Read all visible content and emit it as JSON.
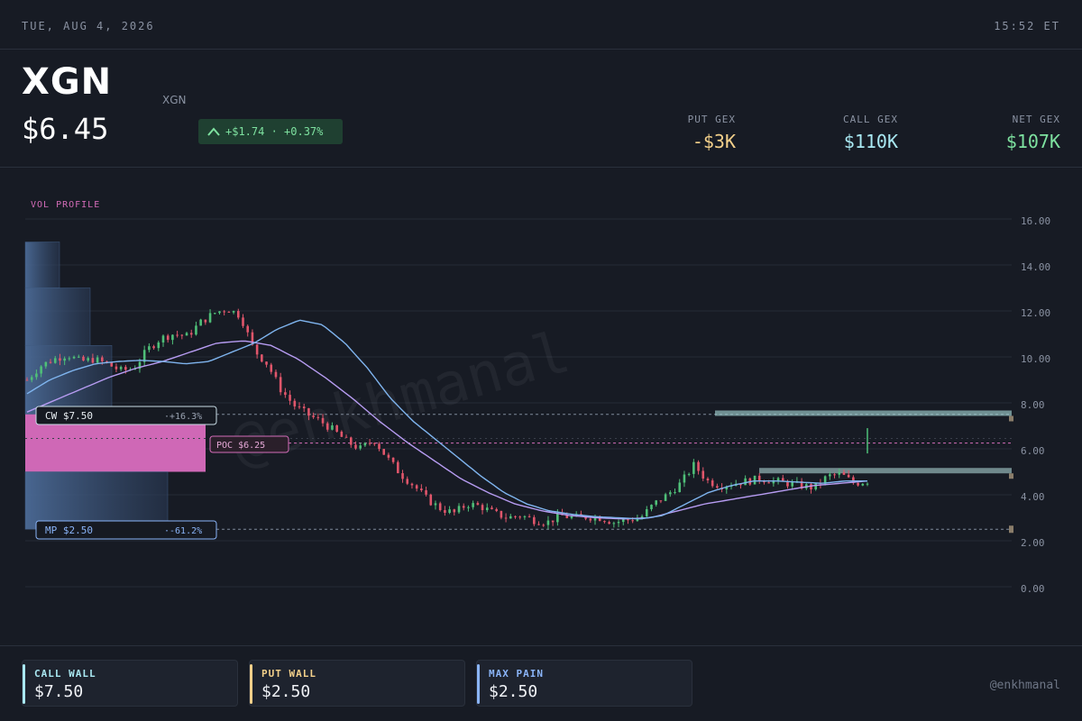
{
  "topbar": {
    "date": "TUE, AUG 4, 2026",
    "time": "15:52 ET"
  },
  "header": {
    "ticker": "XGN",
    "ticker_sub": "XGN",
    "price": "$6.45",
    "change": "+$1.74 · +0.37%",
    "gex": [
      {
        "label": "PUT GEX",
        "value": "-$3K",
        "color": "#f3d08a"
      },
      {
        "label": "CALL GEX",
        "value": "$110K",
        "color": "#a9e8f2"
      },
      {
        "label": "NET GEX",
        "value": "$107K",
        "color": "#7ee2a0"
      }
    ]
  },
  "chart": {
    "profile_label": "VOL PROFILE",
    "watermark": "@enkhmanal",
    "y_ticks": [
      "16.00",
      "14.00",
      "12.00",
      "10.00",
      "8.00",
      "6.00",
      "4.00",
      "2.00",
      "0.00"
    ],
    "tags": {
      "cw": {
        "label": "CW $7.50",
        "pct": "·+16.3%"
      },
      "poc": {
        "label": "POC $6.25"
      },
      "mp": {
        "label": "MP $2.50",
        "pct": "·-61.2%"
      }
    }
  },
  "chart_data": {
    "type": "candlestick",
    "ylim": [
      0,
      16
    ],
    "y_ticks": [
      0,
      2,
      4,
      6,
      8,
      10,
      12,
      14,
      16
    ],
    "levels": {
      "call_wall": 7.5,
      "poc": 6.25,
      "max_pain": 2.5,
      "last": 6.45
    },
    "close_path": [
      9.0,
      9.6,
      9.9,
      10.1,
      9.8,
      9.9,
      9.7,
      9.4,
      9.5,
      10.3,
      10.8,
      11.0,
      10.9,
      11.5,
      11.9,
      12.1,
      11.8,
      10.3,
      9.7,
      8.6,
      7.9,
      7.5,
      7.2,
      6.8,
      6.3,
      6.0,
      6.4,
      5.6,
      4.9,
      4.4,
      3.8,
      3.4,
      3.2,
      3.6,
      3.5,
      3.2,
      3.0,
      3.1,
      2.9,
      2.8,
      3.1,
      3.0,
      3.05,
      3.0,
      2.8,
      2.9,
      3.0,
      3.6,
      4.0,
      4.5,
      5.3,
      4.6,
      4.4,
      4.5,
      4.6,
      4.7,
      4.6,
      4.5,
      4.4,
      4.3,
      4.8,
      4.9,
      4.5,
      4.6
    ],
    "ma_fast_path": [
      8.4,
      9.0,
      9.4,
      9.7,
      9.8,
      9.85,
      9.8,
      9.7,
      9.8,
      10.2,
      10.6,
      11.2,
      11.6,
      11.4,
      10.6,
      9.5,
      8.2,
      7.2,
      6.4,
      5.6,
      4.8,
      4.1,
      3.6,
      3.3,
      3.15,
      3.05,
      3.0,
      2.95,
      3.1,
      3.6,
      4.1,
      4.4,
      4.6,
      4.6,
      4.55,
      4.5,
      4.6,
      4.6
    ],
    "ma_slow_path": [
      7.6,
      8.1,
      8.6,
      9.1,
      9.5,
      9.8,
      10.2,
      10.6,
      10.7,
      10.5,
      9.9,
      9.1,
      8.2,
      7.2,
      6.3,
      5.5,
      4.7,
      4.1,
      3.6,
      3.3,
      3.1,
      3.0,
      2.95,
      3.0,
      3.3,
      3.6,
      3.8,
      4.0,
      4.2,
      4.4,
      4.5,
      4.6
    ],
    "volume_profile": [
      {
        "from": 13.0,
        "to": 15.0,
        "weight": 0.19
      },
      {
        "from": 10.5,
        "to": 13.0,
        "weight": 0.36
      },
      {
        "from": 7.5,
        "to": 10.5,
        "weight": 0.48
      },
      {
        "from": 5.0,
        "to": 7.5,
        "weight": 1.0,
        "poc": true
      },
      {
        "from": 2.5,
        "to": 5.0,
        "weight": 0.79
      }
    ],
    "gex_bars": [
      {
        "level": 7.55,
        "weight": 0.47,
        "color": "#9fcfcf"
      },
      {
        "level": 5.05,
        "weight": 0.4,
        "color": "#9fc4c4"
      }
    ]
  },
  "footer": {
    "cards": [
      {
        "label": "CALL WALL",
        "value": "$7.50",
        "color": "#a9e8f2"
      },
      {
        "label": "PUT WALL",
        "value": "$2.50",
        "color": "#f3d08a"
      },
      {
        "label": "MAX PAIN",
        "value": "$2.50",
        "color": "#8ab4f8"
      }
    ],
    "handle": "@enkhmanal"
  }
}
